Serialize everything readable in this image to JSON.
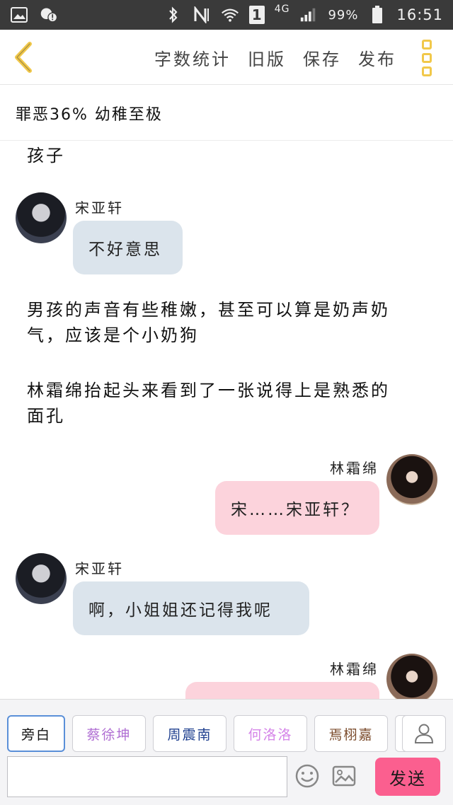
{
  "status_bar": {
    "network": "4G",
    "battery": "99%",
    "time": "16:51",
    "sim_slot": "1"
  },
  "toolbar": {
    "word_count": "字数统计",
    "old_version": "旧版",
    "save": "保存",
    "publish": "发布"
  },
  "story": {
    "title": "罪恶36% 幼稚至极"
  },
  "messages": {
    "narration_1": "孩子",
    "m1": {
      "name": "宋亚轩",
      "text": "不好意思"
    },
    "narration_2a": "男孩的声音有些稚嫩，甚至可以算是奶声奶",
    "narration_2b": "气，应该是个小奶狗",
    "narration_3a": "林霜绵抬起头来看到了一张说得上是熟悉的",
    "narration_3b": "面孔",
    "m2": {
      "name": "林霜绵",
      "text": "宋……宋亚轩？"
    },
    "m3": {
      "name": "宋亚轩",
      "text": "啊，小姐姐还记得我呢"
    },
    "m4": {
      "name": "林霜绵",
      "text": ""
    }
  },
  "characters": {
    "narrator": "旁白",
    "c1": "蔡徐坤",
    "c2": "周震南",
    "c3": "何洛洛",
    "c4": "焉栩嘉"
  },
  "colors": {
    "c1": "#b06fd3",
    "c2": "#1e3f8f",
    "c3": "#d585e8",
    "c4": "#7a4a2a",
    "accent": "#f1c84a",
    "send": "#fb5f8f"
  },
  "input": {
    "placeholder": ""
  },
  "send_label": "发送",
  "icons": [
    "image-icon",
    "alert-icon",
    "bluetooth-icon",
    "wifi-icon",
    "signal-icon",
    "battery-icon",
    "back-icon",
    "menu-icon",
    "user-icon",
    "emoji-icon",
    "picture-icon"
  ]
}
